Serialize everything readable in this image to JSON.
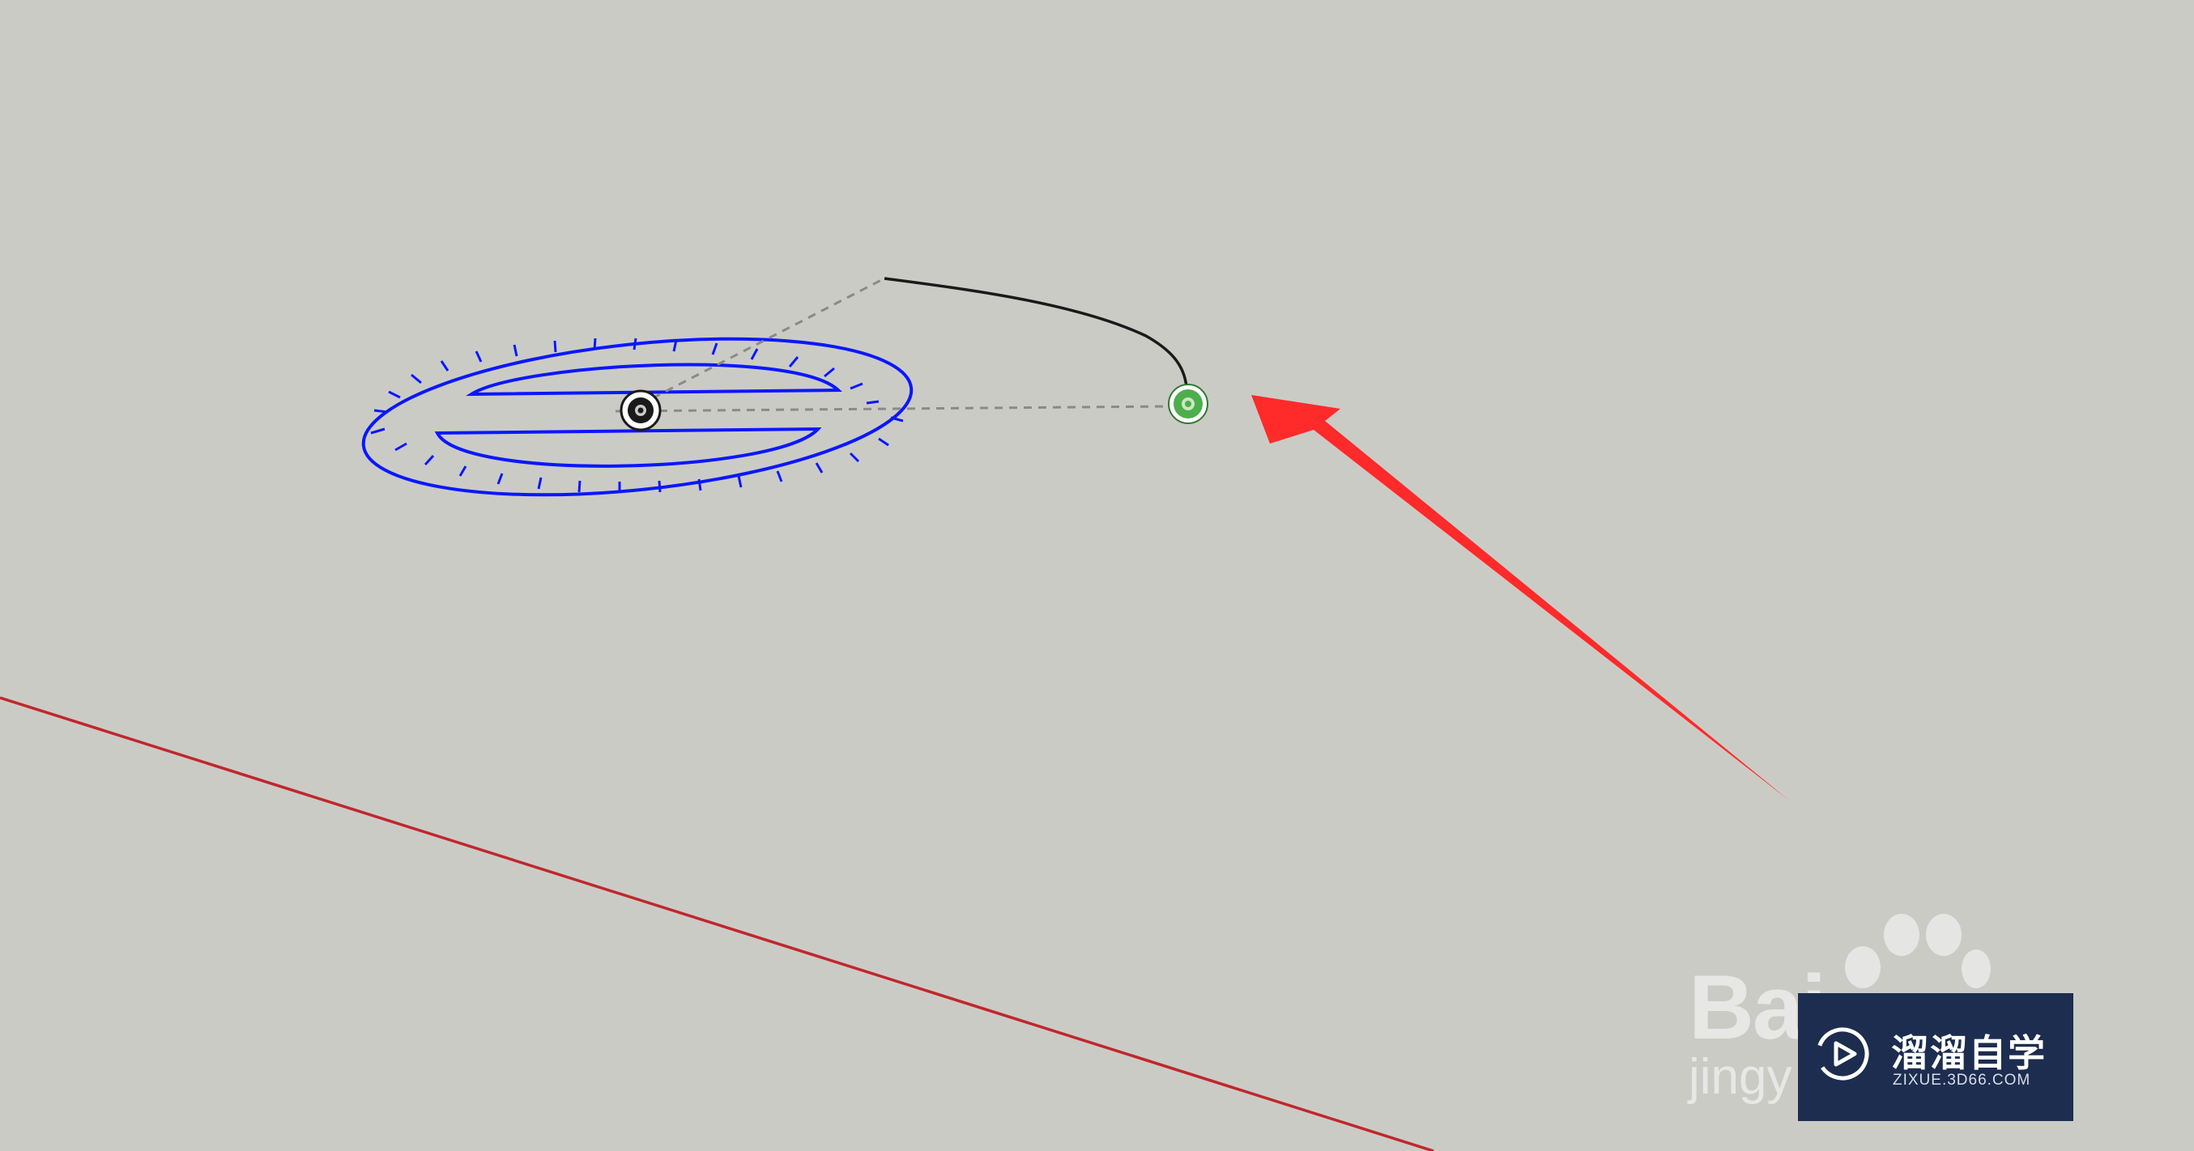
{
  "app": {
    "canvas_background": "#cbcbc6"
  },
  "scene": {
    "red_axis_color": "#c0272d",
    "protractor_color": "#0a17ff",
    "guide_line_color": "#8a8a8a",
    "arc_color": "#1a1a1a",
    "endpoint_inference_color": "#4cae4c",
    "annotation_arrow_color": "#ff2a2a"
  },
  "watermarks": {
    "baidu_text": "Bai",
    "jingyan_text": "jingy",
    "baidu_icon": "paw-icon",
    "site_logo": {
      "name": "溜溜自学",
      "url": "ZIXUE.3D66.COM",
      "icon": "play-icon",
      "background": "#1d2d4f"
    }
  }
}
